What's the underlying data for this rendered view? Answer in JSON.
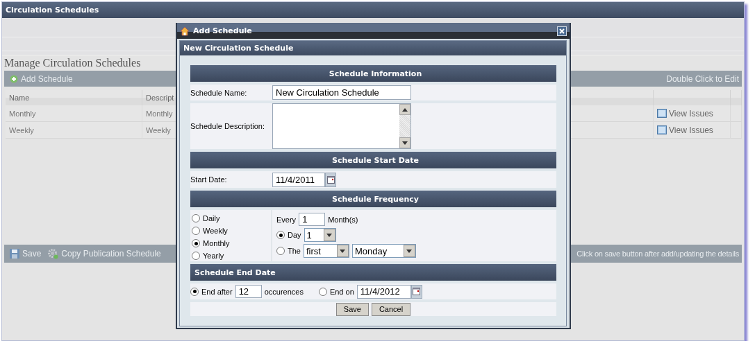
{
  "page": {
    "title": "Circulation Schedules",
    "heading": "Manage Circulation Schedules"
  },
  "toolbar": {
    "add_button": "Add Schedule",
    "hint": "Double Click to Edit"
  },
  "table": {
    "columns": [
      "Name",
      "Descript"
    ],
    "rows": [
      {
        "name": "Monthly",
        "description": "Monthly",
        "action": "View Issues"
      },
      {
        "name": "Weekly",
        "description": "Weekly",
        "action": "View Issues"
      }
    ]
  },
  "bottom_toolbar": {
    "save": "Save",
    "copy": "Copy Publication Schedule",
    "hint": "Click on save button after add/updating the details"
  },
  "dialog": {
    "title": "Add Schedule",
    "panel_title": "New Circulation Schedule",
    "info": {
      "heading": "Schedule Information",
      "name_label": "Schedule Name:",
      "name_value": "New Circulation Schedule",
      "description_label": "Schedule Description:"
    },
    "start": {
      "heading": "Schedule Start Date",
      "label": "Start Date:",
      "value": "11/4/2011"
    },
    "frequency": {
      "heading": "Schedule Frequency",
      "options": [
        {
          "label": "Daily",
          "selected": false
        },
        {
          "label": "Weekly",
          "selected": false
        },
        {
          "label": "Monthly",
          "selected": true
        },
        {
          "label": "Yearly",
          "selected": false
        }
      ],
      "every_label": "Every",
      "every_value": "1",
      "unit": "Month(s)",
      "day": {
        "label": "Day",
        "selected": true,
        "value": "1"
      },
      "the": {
        "label": "The",
        "selected": false,
        "ordinal": "first",
        "weekday": "Monday"
      }
    },
    "end": {
      "heading": "Schedule End Date",
      "after": {
        "label": "End after",
        "selected": true,
        "value": "12",
        "unit": "occurences"
      },
      "on": {
        "label": "End on",
        "selected": false,
        "value": "11/4/2012"
      }
    },
    "buttons": [
      "Save",
      "Cancel"
    ]
  }
}
